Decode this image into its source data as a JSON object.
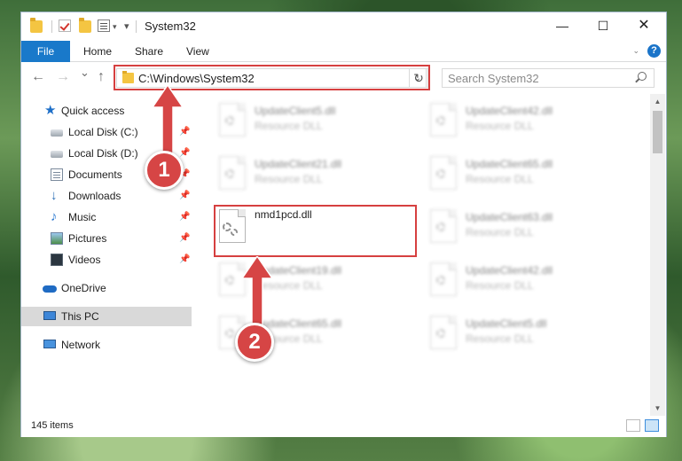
{
  "window": {
    "title": "System32",
    "minimize": "—",
    "maximize": "☐",
    "close": "✕"
  },
  "ribbon": {
    "tabs": [
      "File",
      "Home",
      "Share",
      "View"
    ],
    "help": "?"
  },
  "nav": {
    "back": "←",
    "forward": "→",
    "recent": "⌄",
    "up": "↑",
    "address": "C:\\Windows\\System32",
    "refresh": "↻",
    "search_placeholder": "Search System32"
  },
  "sidebar": {
    "items": [
      {
        "label": "Quick access",
        "icon": "star-icon",
        "pinned": false
      },
      {
        "label": "Local Disk (C:)",
        "icon": "disk-icon",
        "pinned": true
      },
      {
        "label": "Local Disk (D:)",
        "icon": "disk-icon",
        "pinned": true
      },
      {
        "label": "Documents",
        "icon": "documents-icon",
        "pinned": true
      },
      {
        "label": "Downloads",
        "icon": "download-icon",
        "pinned": true
      },
      {
        "label": "Music",
        "icon": "music-icon",
        "pinned": true
      },
      {
        "label": "Pictures",
        "icon": "pictures-icon",
        "pinned": true
      },
      {
        "label": "Videos",
        "icon": "videos-icon",
        "pinned": true
      },
      {
        "label": "OneDrive",
        "icon": "onedrive-icon",
        "pinned": false
      },
      {
        "label": "This PC",
        "icon": "this-pc-icon",
        "pinned": false,
        "selected": true
      },
      {
        "label": "Network",
        "icon": "network-icon",
        "pinned": false
      }
    ]
  },
  "files": {
    "left_column": [
      {
        "name": "UpdateClient5.dll",
        "type": "Resource DLL"
      },
      {
        "name": "UpdateClient21.dll",
        "type": "Resource DLL"
      },
      {
        "name": "nmd1pcd.dll",
        "type": "",
        "highlighted": true
      },
      {
        "name": "UpdateClient19.dll",
        "type": "Resource DLL"
      },
      {
        "name": "UpdateClient65.dll",
        "type": "Resource DLL"
      }
    ],
    "right_column": [
      {
        "name": "UpdateClient42.dll",
        "type": "Resource DLL"
      },
      {
        "name": "UpdateClient65.dll",
        "type": "Resource DLL"
      },
      {
        "name": "UpdateClient63.dll",
        "type": "Resource DLL"
      },
      {
        "name": "UpdateClient42.dll",
        "type": "Resource DLL"
      },
      {
        "name": "UpdateClient5.dll",
        "type": "Resource DLL"
      }
    ]
  },
  "status": {
    "item_count": "145 items"
  },
  "callouts": [
    "1",
    "2"
  ],
  "colors": {
    "accent": "#1979ca",
    "highlight_red": "#d64040",
    "callout_red": "#d64545",
    "folder_yellow": "#f4c542"
  }
}
